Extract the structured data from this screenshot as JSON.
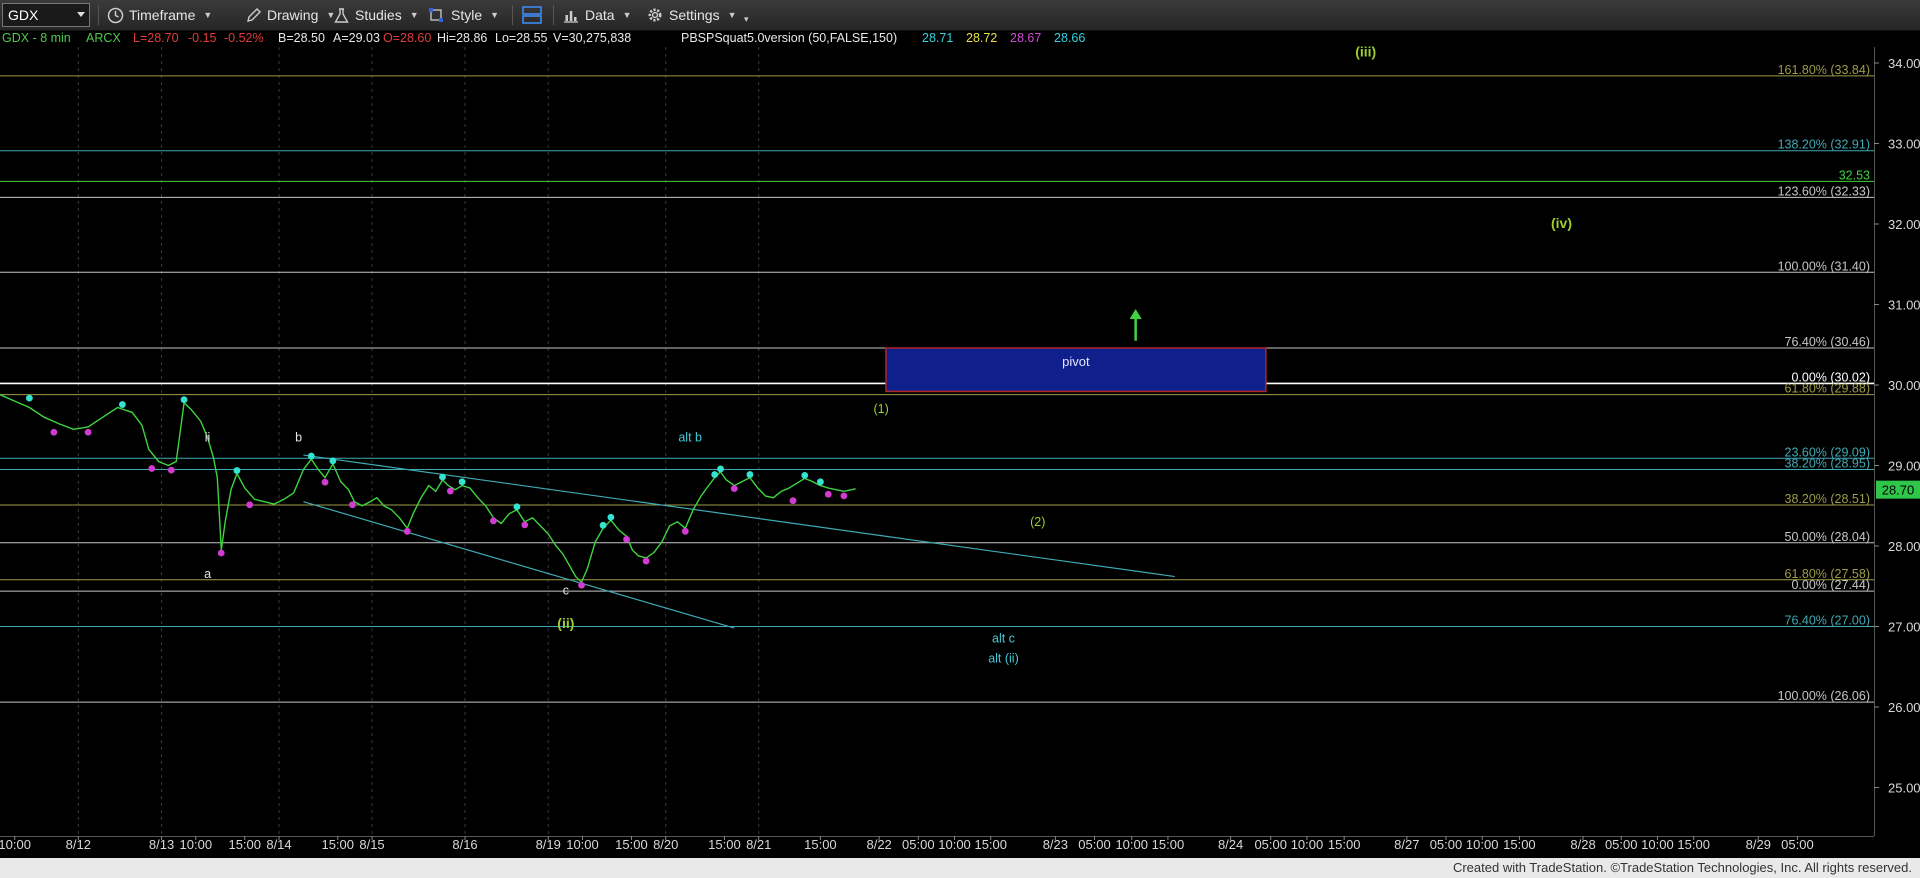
{
  "toolbar": {
    "symbol": "GDX",
    "timeframe_label": "Timeframe",
    "drawing_label": "Drawing",
    "studies_label": "Studies",
    "style_label": "Style",
    "data_label": "Data",
    "settings_label": "Settings"
  },
  "status": {
    "title": "GDX - 8 min",
    "exchange": "ARCX",
    "last": "L=28.70",
    "change": "-0.15",
    "change_pct": "-0.52%",
    "bid": "B=28.50",
    "ask": "A=29.03",
    "open": "O=28.60",
    "high": "Hi=28.86",
    "low": "Lo=28.55",
    "volume": "V=30,275,838",
    "study": "PBSPSquat5.0version (50,FALSE,150)",
    "study_values": [
      "28.71",
      "28.72",
      "28.67",
      "28.66"
    ]
  },
  "footer": {
    "text": "Created with TradeStation. ©TradeStation Technologies, Inc. All rights reserved."
  },
  "colors": {
    "green": "#3fd43f",
    "cyan": "#33e3d0",
    "magenta": "#d23bd2",
    "label_green": "#9ccf2e",
    "label_cyan": "#43c9d6",
    "fib_cyan": "#3fa9b5",
    "fib_olive": "#9c9c47",
    "fib_grey": "#c6c6c6",
    "pivot_fill": "#0f1f8c",
    "pivot_border": "#b12525",
    "price_tag": "#2fc74a"
  },
  "chart_data": {
    "type": "line",
    "symbol": "GDX",
    "interval": "8 min",
    "ylim": [
      24.6,
      34.4
    ],
    "y_ticks": [
      "34.00",
      "33.00",
      "32.00",
      "31.00",
      "30.00",
      "29.00",
      "28.00",
      "27.00",
      "26.00",
      "25.00"
    ],
    "last_price": "28.70",
    "x_labels": [
      {
        "t": 0.15,
        "label": "10:00"
      },
      {
        "t": 0.8,
        "label": "8/12"
      },
      {
        "t": 1.65,
        "label": "8/13"
      },
      {
        "t": 2.0,
        "label": "10:00"
      },
      {
        "t": 2.5,
        "label": "15:00"
      },
      {
        "t": 2.85,
        "label": "8/14"
      },
      {
        "t": 3.45,
        "label": "15:00"
      },
      {
        "t": 3.8,
        "label": "8/15"
      },
      {
        "t": 4.75,
        "label": "8/16"
      },
      {
        "t": 5.6,
        "label": "8/19"
      },
      {
        "t": 5.95,
        "label": "10:00"
      },
      {
        "t": 6.45,
        "label": "15:00"
      },
      {
        "t": 6.8,
        "label": "8/20"
      },
      {
        "t": 7.4,
        "label": "15:00"
      },
      {
        "t": 7.75,
        "label": "8/21"
      },
      {
        "t": 8.38,
        "label": "15:00"
      },
      {
        "t": 8.98,
        "label": "8/22"
      },
      {
        "t": 9.38,
        "label": "05:00"
      },
      {
        "t": 9.75,
        "label": "10:00"
      },
      {
        "t": 10.12,
        "label": "15:00"
      },
      {
        "t": 10.78,
        "label": "8/23"
      },
      {
        "t": 11.18,
        "label": "05:00"
      },
      {
        "t": 11.56,
        "label": "10:00"
      },
      {
        "t": 11.93,
        "label": "15:00"
      },
      {
        "t": 12.57,
        "label": "8/24"
      },
      {
        "t": 12.98,
        "label": "05:00"
      },
      {
        "t": 13.35,
        "label": "10:00"
      },
      {
        "t": 13.73,
        "label": "15:00"
      },
      {
        "t": 14.37,
        "label": "8/27"
      },
      {
        "t": 14.77,
        "label": "05:00"
      },
      {
        "t": 15.14,
        "label": "10:00"
      },
      {
        "t": 15.52,
        "label": "15:00"
      },
      {
        "t": 16.17,
        "label": "8/28"
      },
      {
        "t": 16.56,
        "label": "05:00"
      },
      {
        "t": 16.93,
        "label": "10:00"
      },
      {
        "t": 17.3,
        "label": "15:00"
      },
      {
        "t": 17.96,
        "label": "8/29"
      },
      {
        "t": 18.36,
        "label": "05:00"
      }
    ],
    "price_path": [
      [
        0.0,
        29.88
      ],
      [
        0.15,
        29.8
      ],
      [
        0.3,
        29.72
      ],
      [
        0.45,
        29.6
      ],
      [
        0.6,
        29.52
      ],
      [
        0.75,
        29.45
      ],
      [
        0.9,
        29.48
      ],
      [
        1.05,
        29.6
      ],
      [
        1.2,
        29.72
      ],
      [
        1.35,
        29.66
      ],
      [
        1.45,
        29.5
      ],
      [
        1.52,
        29.2
      ],
      [
        1.62,
        29.05
      ],
      [
        1.72,
        29.0
      ],
      [
        1.8,
        29.05
      ],
      [
        1.88,
        29.78
      ],
      [
        1.95,
        29.7
      ],
      [
        2.05,
        29.55
      ],
      [
        2.12,
        29.35
      ],
      [
        2.18,
        29.1
      ],
      [
        2.22,
        28.85
      ],
      [
        2.26,
        27.95
      ],
      [
        2.3,
        28.3
      ],
      [
        2.36,
        28.7
      ],
      [
        2.42,
        28.9
      ],
      [
        2.5,
        28.72
      ],
      [
        2.6,
        28.58
      ],
      [
        2.7,
        28.55
      ],
      [
        2.8,
        28.52
      ],
      [
        2.9,
        28.58
      ],
      [
        3.0,
        28.66
      ],
      [
        3.1,
        28.95
      ],
      [
        3.18,
        29.08
      ],
      [
        3.25,
        28.95
      ],
      [
        3.32,
        28.85
      ],
      [
        3.4,
        29.02
      ],
      [
        3.48,
        28.8
      ],
      [
        3.56,
        28.7
      ],
      [
        3.62,
        28.55
      ],
      [
        3.7,
        28.5
      ],
      [
        3.78,
        28.55
      ],
      [
        3.85,
        28.6
      ],
      [
        3.92,
        28.5
      ],
      [
        4.0,
        28.45
      ],
      [
        4.08,
        28.35
      ],
      [
        4.16,
        28.22
      ],
      [
        4.22,
        28.4
      ],
      [
        4.3,
        28.6
      ],
      [
        4.38,
        28.75
      ],
      [
        4.45,
        28.68
      ],
      [
        4.52,
        28.82
      ],
      [
        4.58,
        28.75
      ],
      [
        4.65,
        28.7
      ],
      [
        4.72,
        28.75
      ],
      [
        4.8,
        28.72
      ],
      [
        4.88,
        28.6
      ],
      [
        4.96,
        28.5
      ],
      [
        5.04,
        28.35
      ],
      [
        5.12,
        28.28
      ],
      [
        5.2,
        28.4
      ],
      [
        5.28,
        28.45
      ],
      [
        5.36,
        28.3
      ],
      [
        5.44,
        28.35
      ],
      [
        5.52,
        28.25
      ],
      [
        5.6,
        28.15
      ],
      [
        5.68,
        28.0
      ],
      [
        5.75,
        27.9
      ],
      [
        5.82,
        27.75
      ],
      [
        5.88,
        27.62
      ],
      [
        5.94,
        27.55
      ],
      [
        6.0,
        27.72
      ],
      [
        6.08,
        28.05
      ],
      [
        6.16,
        28.22
      ],
      [
        6.24,
        28.32
      ],
      [
        6.32,
        28.2
      ],
      [
        6.4,
        28.12
      ],
      [
        6.46,
        27.95
      ],
      [
        6.52,
        27.88
      ],
      [
        6.6,
        27.85
      ],
      [
        6.68,
        27.92
      ],
      [
        6.76,
        28.05
      ],
      [
        6.84,
        28.25
      ],
      [
        6.92,
        28.3
      ],
      [
        7.0,
        28.22
      ],
      [
        7.08,
        28.45
      ],
      [
        7.16,
        28.62
      ],
      [
        7.22,
        28.72
      ],
      [
        7.3,
        28.85
      ],
      [
        7.36,
        28.92
      ],
      [
        7.42,
        28.82
      ],
      [
        7.5,
        28.75
      ],
      [
        7.58,
        28.8
      ],
      [
        7.66,
        28.85
      ],
      [
        7.74,
        28.72
      ],
      [
        7.82,
        28.62
      ],
      [
        7.9,
        28.6
      ],
      [
        7.98,
        28.68
      ],
      [
        8.06,
        28.72
      ],
      [
        8.14,
        28.78
      ],
      [
        8.22,
        28.84
      ],
      [
        8.3,
        28.8
      ],
      [
        8.38,
        28.75
      ],
      [
        8.46,
        28.72
      ],
      [
        8.54,
        28.7
      ],
      [
        8.62,
        28.68
      ],
      [
        8.7,
        28.7
      ],
      [
        8.74,
        28.71
      ]
    ],
    "swing_low_markers": [
      [
        0.55,
        29.45
      ],
      [
        0.9,
        29.45
      ],
      [
        1.55,
        29.0
      ],
      [
        1.75,
        28.98
      ],
      [
        2.26,
        27.95
      ],
      [
        2.55,
        28.55
      ],
      [
        3.32,
        28.83
      ],
      [
        3.6,
        28.55
      ],
      [
        4.16,
        28.22
      ],
      [
        4.6,
        28.72
      ],
      [
        5.04,
        28.35
      ],
      [
        5.36,
        28.3
      ],
      [
        5.94,
        27.55
      ],
      [
        6.4,
        28.12
      ],
      [
        6.6,
        27.85
      ],
      [
        7.0,
        28.22
      ],
      [
        7.5,
        28.75
      ],
      [
        8.1,
        28.6
      ],
      [
        8.46,
        28.68
      ],
      [
        8.62,
        28.66
      ]
    ],
    "swing_high_markers": [
      [
        0.3,
        29.8
      ],
      [
        1.25,
        29.72
      ],
      [
        1.88,
        29.78
      ],
      [
        2.42,
        28.9
      ],
      [
        3.18,
        29.08
      ],
      [
        3.4,
        29.02
      ],
      [
        4.52,
        28.82
      ],
      [
        4.72,
        28.76
      ],
      [
        5.28,
        28.45
      ],
      [
        6.16,
        28.22
      ],
      [
        6.24,
        28.32
      ],
      [
        7.3,
        28.85
      ],
      [
        7.36,
        28.92
      ],
      [
        7.66,
        28.85
      ],
      [
        8.22,
        28.84
      ],
      [
        8.38,
        28.76
      ]
    ],
    "fib_lines": [
      {
        "value": 33.84,
        "label": "161.80% (33.84)",
        "tone": "olive"
      },
      {
        "value": 32.91,
        "label": "138.20% (32.91)",
        "tone": "cyan"
      },
      {
        "value": 32.53,
        "label": "32.53",
        "tone": "green"
      },
      {
        "value": 32.33,
        "label": "123.60% (32.33)",
        "tone": "grey"
      },
      {
        "value": 31.4,
        "label": "100.00% (31.40)",
        "tone": "grey"
      },
      {
        "value": 30.46,
        "label": "76.40% (30.46)",
        "tone": "grey"
      },
      {
        "value": 30.02,
        "label": "0.00% (30.02)",
        "tone": "white"
      },
      {
        "value": 29.88,
        "label": "61.80% (29.88)",
        "tone": "olive"
      },
      {
        "value": 29.09,
        "label": "23.60% (29.09)",
        "tone": "cyan"
      },
      {
        "value": 28.95,
        "label": "38.20% (28.95)",
        "tone": "cyan"
      },
      {
        "value": 28.51,
        "label": "38.20% (28.51)",
        "tone": "olive"
      },
      {
        "value": 28.04,
        "label": "50.00% (28.04)",
        "tone": "grey"
      },
      {
        "value": 27.58,
        "label": "61.80% (27.58)",
        "tone": "olive"
      },
      {
        "value": 27.44,
        "label": "0.00% (27.44)",
        "tone": "grey"
      },
      {
        "value": 27.0,
        "label": "76.40% (27.00)",
        "tone": "cyan"
      },
      {
        "value": 26.06,
        "label": "100.00% (26.06)",
        "tone": "grey"
      }
    ],
    "pivot_box": {
      "label": "pivot",
      "t_start": 9.05,
      "t_end": 12.93,
      "y_low": 29.92,
      "y_high": 30.46
    },
    "trendlines": [
      {
        "from": [
          3.1,
          29.13
        ],
        "to": [
          12.0,
          27.62
        ]
      },
      {
        "from": [
          3.1,
          28.55
        ],
        "to": [
          7.5,
          26.98
        ]
      }
    ],
    "arrow": {
      "t": 11.6,
      "y_from": 30.55,
      "y_to": 30.92
    },
    "wave_labels": [
      {
        "t": 13.95,
        "y": 34.08,
        "text": "(iii)",
        "tone": "green",
        "bold": true
      },
      {
        "t": 15.95,
        "y": 31.95,
        "text": "(iv)",
        "tone": "green",
        "bold": true
      },
      {
        "t": 5.78,
        "y": 26.98,
        "text": "(ii)",
        "tone": "green",
        "bold": true
      },
      {
        "t": 9.0,
        "y": 29.65,
        "text": "(1)",
        "tone": "green",
        "bold": false
      },
      {
        "t": 10.6,
        "y": 28.25,
        "text": "(2)",
        "tone": "green",
        "bold": false
      },
      {
        "t": 2.12,
        "y": 29.3,
        "text": "ii",
        "tone": "white",
        "bold": false
      },
      {
        "t": 2.12,
        "y": 27.6,
        "text": "a",
        "tone": "white",
        "bold": false
      },
      {
        "t": 3.05,
        "y": 29.3,
        "text": "b",
        "tone": "white",
        "bold": false
      },
      {
        "t": 5.78,
        "y": 27.4,
        "text": "c",
        "tone": "white",
        "bold": false
      },
      {
        "t": 7.05,
        "y": 29.3,
        "text": "alt b",
        "tone": "cyan",
        "bold": false
      },
      {
        "t": 10.25,
        "y": 26.8,
        "text": "alt c",
        "tone": "cyan",
        "bold": false
      },
      {
        "t": 10.25,
        "y": 26.55,
        "text": "alt (ii)",
        "tone": "cyan",
        "bold": false
      }
    ]
  }
}
